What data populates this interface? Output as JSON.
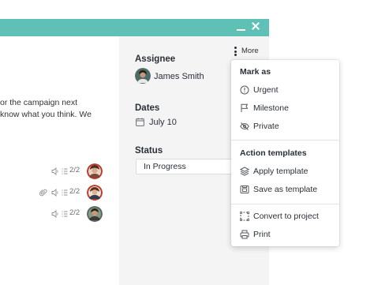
{
  "window": {
    "accent_color": "#5fc0b6",
    "minimize_icon": "minimize-icon",
    "close_icon": "close-icon"
  },
  "content": {
    "lines": [
      "or the campaign next",
      "know what you think. We"
    ]
  },
  "subtasks": [
    {
      "subtask_count": "2/2",
      "has_attachment": false
    },
    {
      "subtask_count": "2/2",
      "has_attachment": true
    },
    {
      "subtask_count": "2/2",
      "has_attachment": false
    }
  ],
  "details": {
    "assignee_label": "Assignee",
    "assignee_name": "James Smith",
    "dates_label": "Dates",
    "date_value": "July 10",
    "status_label": "Status",
    "status_value": "In Progress"
  },
  "more_button": {
    "label": "More"
  },
  "menu": {
    "mark_as_title": "Mark as",
    "mark_as_items": [
      {
        "label": "Urgent",
        "icon": "alert-circle-icon"
      },
      {
        "label": "Milestone",
        "icon": "flag-icon"
      },
      {
        "label": "Private",
        "icon": "eye-off-icon"
      }
    ],
    "templates_title": "Action templates",
    "template_items": [
      {
        "label": "Apply template",
        "icon": "layers-icon"
      },
      {
        "label": "Save as template",
        "icon": "save-template-icon"
      }
    ],
    "other_items": [
      {
        "label": "Convert to project",
        "icon": "convert-icon"
      },
      {
        "label": "Print",
        "icon": "printer-icon"
      }
    ]
  }
}
